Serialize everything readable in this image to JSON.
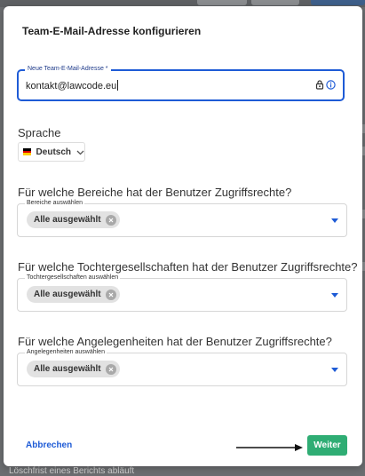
{
  "dialog": {
    "title": "Team-E-Mail-Adresse konfigurieren"
  },
  "email": {
    "label": "Neue Team-E-Mail-Adresse *",
    "value": "kontakt@lawcode.eu"
  },
  "language": {
    "heading": "Sprache",
    "selected": "Deutsch"
  },
  "access": [
    {
      "question": "Für welche Bereiche hat der Benutzer Zugriffsrechte?",
      "field_label": "Bereiche auswählen",
      "chip": "Alle ausgewählt"
    },
    {
      "question": "Für welche Tochtergesellschaften hat der Benutzer Zugriffsrechte?",
      "field_label": "Tochtergesellschaften auswählen",
      "chip": "Alle ausgewählt"
    },
    {
      "question": "Für welche Angelegenheiten hat der Benutzer Zugriffsrechte?",
      "field_label": "Angelegenheiten auswählen",
      "chip": "Alle ausgewählt"
    }
  ],
  "footer": {
    "cancel_label": "Abbrechen",
    "submit_label": "Weiter"
  },
  "background": {
    "partial_text": "Löschfrist eines Berichts abläuft"
  },
  "colors": {
    "accent": "#1e5bd6",
    "submit": "#2fad74",
    "chip": "#e2e2e2"
  }
}
